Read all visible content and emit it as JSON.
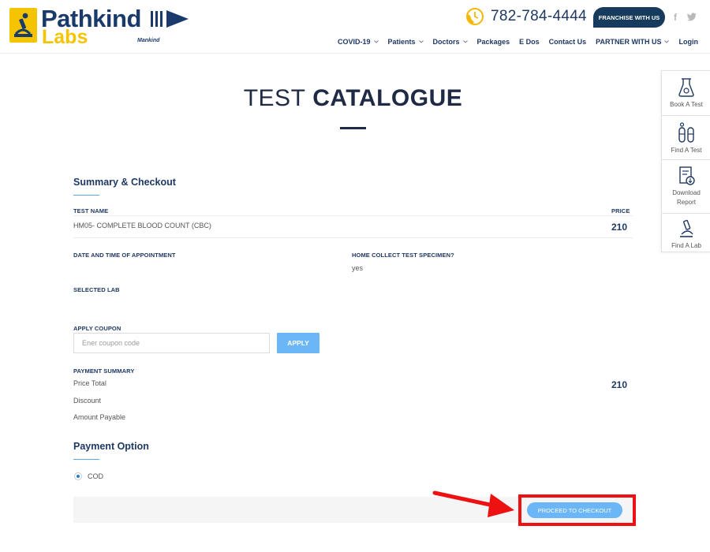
{
  "header": {
    "brand_name": "Pathkind",
    "brand_sub": "Labs",
    "brand_partner": "Mankind",
    "phone": "782-784-4444",
    "franchise_label": "FRANCHISE WITH US",
    "social_fb": "f",
    "nav": [
      {
        "label": "COVID-19",
        "dropdown": true
      },
      {
        "label": "Patients",
        "dropdown": true
      },
      {
        "label": "Doctors",
        "dropdown": true
      },
      {
        "label": "Packages",
        "dropdown": false
      },
      {
        "label": "E Dos",
        "dropdown": false
      },
      {
        "label": "Contact Us",
        "dropdown": false
      },
      {
        "label": "PARTNER WITH US",
        "dropdown": true
      },
      {
        "label": "Login",
        "dropdown": false
      }
    ]
  },
  "page_title": {
    "light": "TEST",
    "bold": "CATALOGUE"
  },
  "side_panel": [
    {
      "label": "Book A Test",
      "icon": "flask-icon"
    },
    {
      "label": "Find A Test",
      "icon": "test-tubes-icon"
    },
    {
      "label": "Download Report",
      "icon": "report-icon"
    },
    {
      "label": "Find A Lab",
      "icon": "microscope-icon"
    }
  ],
  "summary": {
    "heading": "Summary & Checkout",
    "test_name_label": "TEST NAME",
    "price_label": "PRICE",
    "test_name": "HM05- COMPLETE BLOOD COUNT (CBC)",
    "test_price": "210",
    "appointment_label": "DATE AND TIME OF APPOINTMENT",
    "home_collect_label": "HOME COLLECT TEST SPECIMEN?",
    "home_collect_value": "yes",
    "selected_lab_label": "SELECTED LAB"
  },
  "coupon": {
    "label": "APPLY COUPON",
    "placeholder": "Ener coupon code",
    "apply_label": "APPLY"
  },
  "payment_summary": {
    "label": "PAYMENT SUMMARY",
    "price_total_label": "Price Total",
    "price_total": "210",
    "discount_label": "Discount",
    "amount_payable_label": "Amount Payable"
  },
  "payment_option": {
    "heading": "Payment Option",
    "cod_label": "COD",
    "cod_selected": true
  },
  "checkout": {
    "button_label": "PROCEED TO CHECKOUT"
  },
  "colors": {
    "brand_navy": "#1f3864",
    "brand_yellow": "#f5c400",
    "accent_blue": "#6ab6f7",
    "highlight_red": "#ee1111"
  }
}
